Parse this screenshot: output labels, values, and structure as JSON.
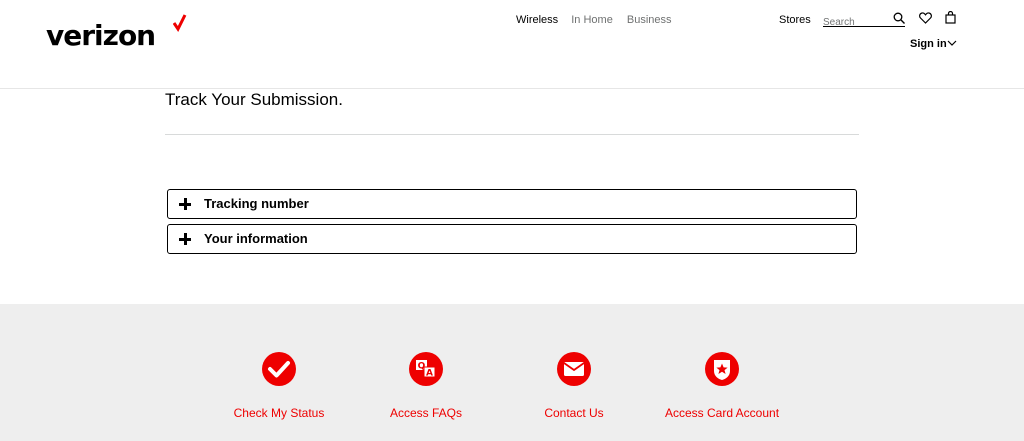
{
  "header": {
    "brand": "verizon",
    "nav": [
      "Wireless",
      "In Home",
      "Business"
    ],
    "stores": "Stores",
    "search_placeholder": "Search",
    "signin": "Sign in"
  },
  "main": {
    "title": "Track Your Submission.",
    "accordions": [
      {
        "label": "Tracking number"
      },
      {
        "label": "Your information"
      }
    ]
  },
  "footer": {
    "items": [
      {
        "label": "Check My Status",
        "icon": "check-circle-icon"
      },
      {
        "label": "Access FAQs",
        "icon": "faq-icon"
      },
      {
        "label": "Contact Us",
        "icon": "envelope-icon"
      },
      {
        "label": "Access Card Account",
        "icon": "star-badge-icon"
      }
    ]
  },
  "colors": {
    "brand_red": "#ee0000",
    "footer_bg": "#eeeeee"
  }
}
